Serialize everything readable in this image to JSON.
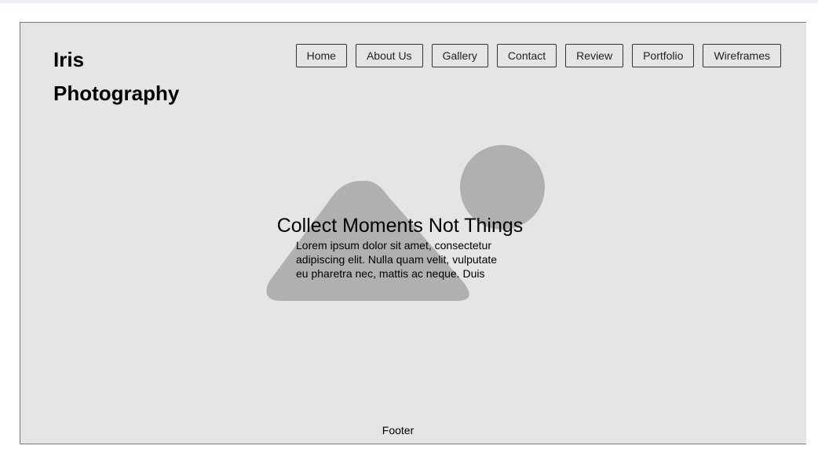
{
  "header": {
    "logo_line1": "Iris",
    "logo_line2": "Photography"
  },
  "nav": {
    "items": [
      "Home",
      "About Us",
      "Gallery",
      "Contact",
      "Review",
      "Portfolio",
      "Wireframes"
    ]
  },
  "hero": {
    "image_icon": "image-placeholder-icon",
    "title": "Collect Moments Not Things",
    "text": "Lorem ipsum dolor sit amet, consectetur adipiscing elit. Nulla quam velit, vulputate eu pharetra nec, mattis ac neque. Duis"
  },
  "footer": {
    "text": "Footer"
  },
  "colors": {
    "background": "#e5e5e5",
    "placeholder": "#b0b0b0",
    "border": "#333333"
  }
}
